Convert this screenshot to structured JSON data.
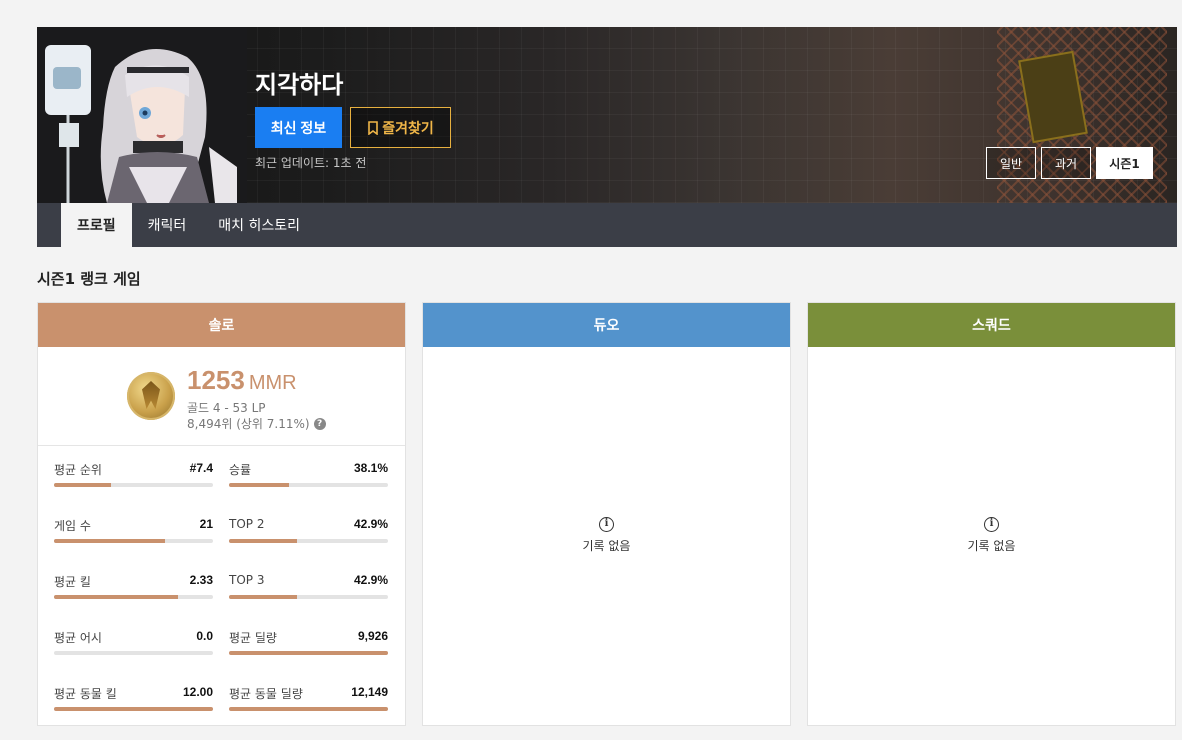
{
  "profile": {
    "name": "지각하다",
    "latest_button": "최신 정보",
    "favorite_button": "즐겨찾기",
    "updated_text": "최근 업데이트: 1초 전"
  },
  "season_tabs": [
    "일반",
    "과거",
    "시즌1"
  ],
  "nav": [
    "프로필",
    "캐릭터",
    "매치 히스토리"
  ],
  "section_title": "시즌1 랭크 게임",
  "colors": {
    "solo": "#c9916d",
    "duo": "#5393cc",
    "squad": "#7a8f3a",
    "accent": "#1a7ef2"
  },
  "solo": {
    "header": "솔로",
    "mmr": "1253",
    "mmr_unit": "MMR",
    "tier": "골드 4 - 53 LP",
    "rank": "8,494위 (상위 7.11%)",
    "stats": [
      {
        "label": "평균 순위",
        "value": "#7.4",
        "level": 0.36
      },
      {
        "label": "승률",
        "value": "38.1%",
        "level": 0.38
      },
      {
        "label": "게임 수",
        "value": "21",
        "level": 0.7
      },
      {
        "label": "TOP 2",
        "value": "42.9%",
        "level": 0.43
      },
      {
        "label": "평균 킬",
        "value": "2.33",
        "level": 0.78
      },
      {
        "label": "TOP 3",
        "value": "42.9%",
        "level": 0.43
      },
      {
        "label": "평균 어시",
        "value": "0.0",
        "level": 0
      },
      {
        "label": "평균 딜량",
        "value": "9,926",
        "level": 1
      },
      {
        "label": "평균 동물 킬",
        "value": "12.00",
        "level": 1
      },
      {
        "label": "평균 동물 딜량",
        "value": "12,149",
        "level": 1
      }
    ]
  },
  "duo": {
    "header": "듀오",
    "empty_text": "기록 없음"
  },
  "squad": {
    "header": "스쿼드",
    "empty_text": "기록 없음"
  }
}
